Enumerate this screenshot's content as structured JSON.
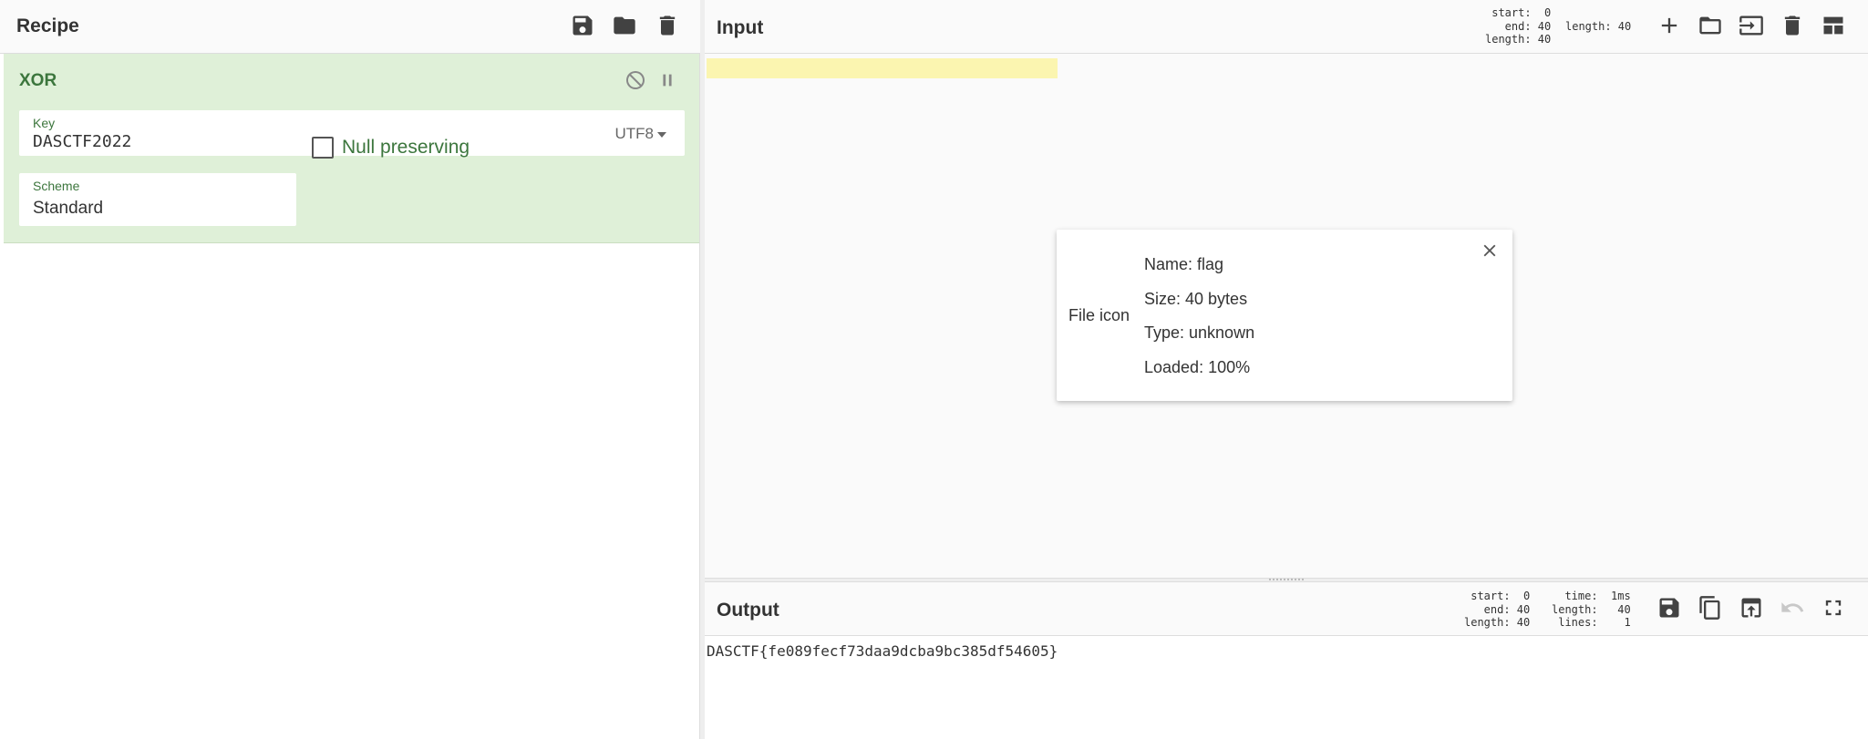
{
  "recipe": {
    "title": "Recipe",
    "operation": {
      "name": "XOR",
      "key_label": "Key",
      "key_value": "DASCTF2022",
      "key_encoding": "UTF8",
      "scheme_label": "Scheme",
      "scheme_value": "Standard",
      "null_preserving_label": "Null preserving",
      "null_preserving_checked": false
    }
  },
  "input": {
    "title": "Input",
    "stats": {
      "start": "start:  0",
      "end": "  end: 40",
      "length": "length: 40",
      "length_right": "length: 40"
    },
    "file": {
      "icon_label": "File icon",
      "name": "Name: flag",
      "size": "Size: 40 bytes",
      "type": "Type: unknown",
      "loaded": "Loaded: 100%"
    }
  },
  "output": {
    "title": "Output",
    "stats": {
      "start": "start:  0",
      "end": "  end: 40",
      "length": "length: 40",
      "time": "  time:  1ms",
      "length2": "length:   40",
      "lines": " lines:    1"
    },
    "text": "DASCTF{fe089fecf73daa9dcba9bc385df54605}"
  },
  "colors": {
    "accent": "#3c763d",
    "operation_bg": "#dff0d8",
    "highlight": "#fbf5b0"
  }
}
